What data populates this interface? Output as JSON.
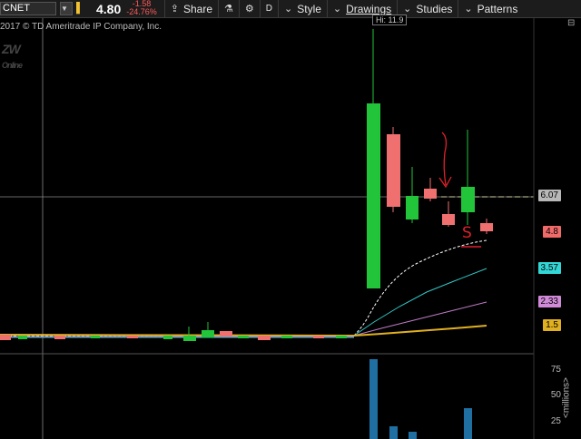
{
  "toolbar": {
    "symbol": "CNET",
    "last_price": "4.80",
    "net_change": "-1.58",
    "pct_change": "-24.76%",
    "share_label": "Share",
    "style_label": "Style",
    "drawings_label": "Drawings",
    "studies_label": "Studies",
    "patterns_label": "Patterns",
    "aggregation_label": "D"
  },
  "chart": {
    "copyright": "2017 © TD Ameritrade IP Company, Inc.",
    "logo_text": "ZW",
    "logo_sub": "Online",
    "high_tag": "Hi: 11.9",
    "price_labels": [
      {
        "text": "6.07",
        "color": "#b8b8b8"
      },
      {
        "text": "4.8",
        "color": "#f06a6a"
      },
      {
        "text": "3.57",
        "color": "#33d6d6"
      },
      {
        "text": "2.33",
        "color": "#d08ad8"
      },
      {
        "text": "1.5",
        "color": "#e0b020"
      }
    ],
    "volume_ticks": [
      "75",
      "50",
      "25"
    ],
    "volume_unit": "<millions>",
    "annotation_letter": "S"
  },
  "colors": {
    "up": "#22c43a",
    "down": "#f07070",
    "bg": "#000000",
    "annotation": "#e0202c"
  }
}
